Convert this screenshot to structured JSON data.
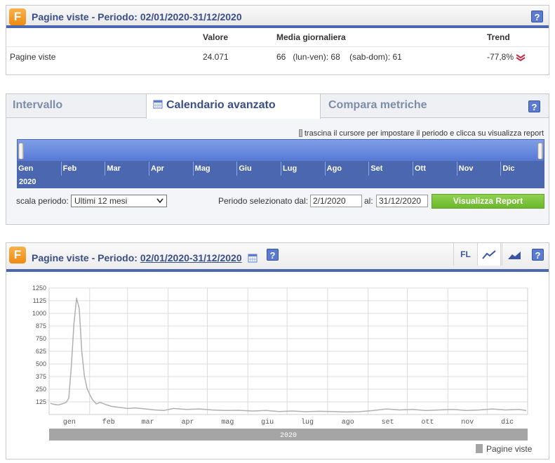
{
  "summary": {
    "logo_letter": "F",
    "title": "Pagine viste - Periodo: 02/01/2020-31/12/2020",
    "help": "?",
    "headers": {
      "valore": "Valore",
      "media": "Media giornaliera",
      "trend": "Trend"
    },
    "row": {
      "label": "Pagine viste",
      "valore": "24.071",
      "media_total": "66",
      "media_weekday": "(lun-ven): 68",
      "media_weekend": "(sab-dom): 61",
      "trend": "-77,8%"
    },
    "trend_icon": "double-chevron-down-icon"
  },
  "calendar": {
    "tabs": [
      "Intervallo",
      "Calendario avanzato",
      "Compara metriche"
    ],
    "active_tab": 1,
    "help": "?",
    "hint": "trascina il cursore per impostare il periodo e clicca su visualizza report",
    "months": [
      "Gen",
      "Feb",
      "Mar",
      "Apr",
      "Mag",
      "Giu",
      "Lug",
      "Ago",
      "Set",
      "Ott",
      "Nov",
      "Dic"
    ],
    "year": "2020",
    "scale_label": "scala periodo:",
    "scale_value": "Ultimi 12 mesi",
    "period_from_label": "Periodo selezionato dal:",
    "period_from": "2/1/2020",
    "period_to_label": "al:",
    "period_to": "31/12/2020",
    "view_button": "Visualizza Report",
    "accent": "#4a67b0"
  },
  "chart_panel": {
    "logo_letter": "F",
    "title_prefix": "Pagine viste - Periodo:",
    "title_period": "02/01/2020-31/12/2020",
    "help": "?",
    "toolbar": {
      "fl": "FL",
      "line_icon": "line-chart-icon",
      "area_icon": "area-chart-icon",
      "help": "?"
    },
    "legend": "Pagine viste",
    "year_band": "2020"
  },
  "chart_data": {
    "type": "line",
    "ylim": [
      0,
      1250
    ],
    "y_ticks": [
      125,
      250,
      375,
      500,
      625,
      750,
      875,
      1000,
      1125,
      1250
    ],
    "x_ticks": [
      "gen",
      "feb",
      "mar",
      "apr",
      "mag",
      "giu",
      "lug",
      "ago",
      "set",
      "ott",
      "nov",
      "dic"
    ],
    "year_label": "2020",
    "grid": true,
    "legend_position": "bottom-right",
    "series": [
      {
        "name": "Pagine viste",
        "color": "#b0b0b0",
        "x": [
          "2020-01-02",
          "2020-01-05",
          "2020-01-08",
          "2020-01-11",
          "2020-01-14",
          "2020-01-16",
          "2020-01-18",
          "2020-01-20",
          "2020-01-22",
          "2020-01-24",
          "2020-01-26",
          "2020-01-28",
          "2020-01-30",
          "2020-02-01",
          "2020-02-03",
          "2020-02-06",
          "2020-02-09",
          "2020-02-13",
          "2020-02-18",
          "2020-02-24",
          "2020-03-01",
          "2020-03-07",
          "2020-03-15",
          "2020-03-22",
          "2020-03-29",
          "2020-04-05",
          "2020-04-15",
          "2020-04-25",
          "2020-05-05",
          "2020-05-15",
          "2020-05-25",
          "2020-06-05",
          "2020-06-15",
          "2020-06-25",
          "2020-07-05",
          "2020-07-15",
          "2020-07-25",
          "2020-08-05",
          "2020-08-15",
          "2020-08-25",
          "2020-09-05",
          "2020-09-15",
          "2020-09-25",
          "2020-10-05",
          "2020-10-15",
          "2020-10-25",
          "2020-11-05",
          "2020-11-15",
          "2020-11-25",
          "2020-12-05",
          "2020-12-15",
          "2020-12-25",
          "2020-12-31"
        ],
        "values": [
          110,
          100,
          95,
          105,
          120,
          160,
          480,
          900,
          1150,
          1050,
          620,
          380,
          260,
          200,
          150,
          105,
          120,
          100,
          80,
          70,
          60,
          65,
          55,
          45,
          40,
          60,
          50,
          55,
          45,
          40,
          42,
          35,
          40,
          30,
          35,
          28,
          32,
          30,
          25,
          28,
          40,
          55,
          45,
          50,
          40,
          45,
          50,
          40,
          45,
          55,
          45,
          50,
          40
        ]
      }
    ]
  }
}
